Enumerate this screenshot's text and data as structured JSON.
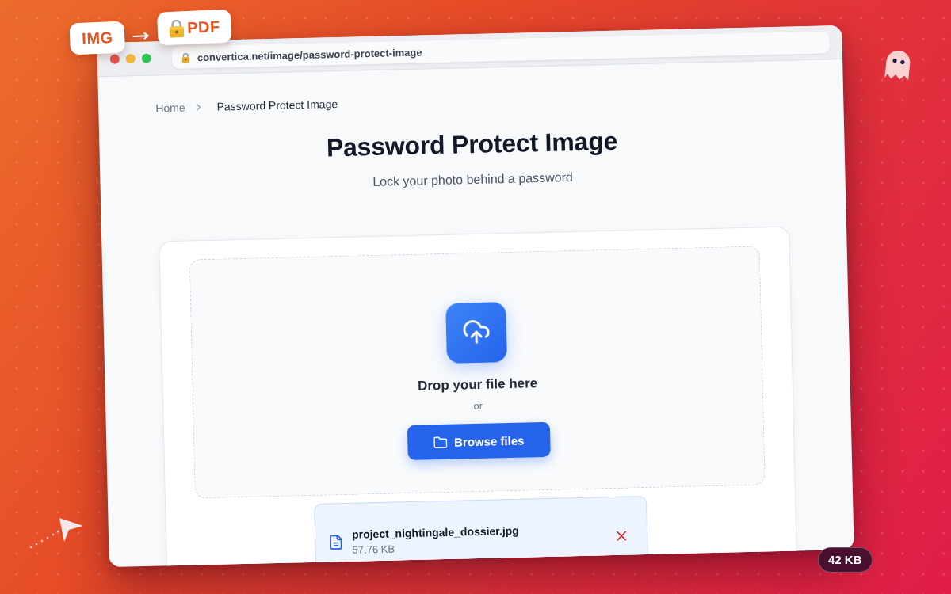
{
  "conversion_badges": [
    {
      "label": "IMG",
      "kind": "plain"
    },
    {
      "label": "PDF",
      "kind": "locked"
    }
  ],
  "browser": {
    "url": "convertica.net/image/password-protect-image",
    "secure": true
  },
  "breadcrumb": [
    {
      "label": "Home",
      "current": false
    },
    {
      "label": "Password Protect Image",
      "current": true
    }
  ],
  "page": {
    "title": "Password Protect Image",
    "subtitle": "Lock your photo behind a password"
  },
  "dropzone": {
    "prompt": "Drop your file here",
    "separator": "or",
    "button": "Browse files"
  },
  "files": [
    {
      "name": "project_nightingale_dossier.jpg",
      "size": "57.76 KB"
    }
  ],
  "size_badge": {
    "label": "42 KB"
  }
}
